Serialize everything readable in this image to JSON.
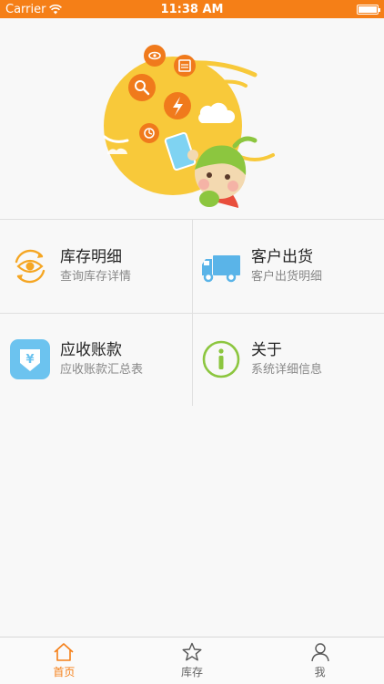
{
  "status_bar": {
    "carrier": "Carrier",
    "time": "11:38 AM"
  },
  "colors": {
    "accent": "#f57f17",
    "hero_yellow": "#f8c93a",
    "icon_orange": "#f07a1c",
    "icon_blue": "#5ab4e8",
    "icon_green": "#8cc63f"
  },
  "menu": {
    "inventory": {
      "title": "库存明细",
      "subtitle": "查询库存详情",
      "icon": "eye-sync-icon"
    },
    "shipment": {
      "title": "客户出货",
      "subtitle": "客户出货明细",
      "icon": "truck-icon"
    },
    "receivables": {
      "title": "应收账款",
      "subtitle": "应收账款汇总表",
      "icon": "yen-download-icon"
    },
    "about": {
      "title": "关于",
      "subtitle": "系统详细信息",
      "icon": "info-icon"
    }
  },
  "tabbar": {
    "home": "首页",
    "inventory": "库存",
    "me": "我"
  }
}
